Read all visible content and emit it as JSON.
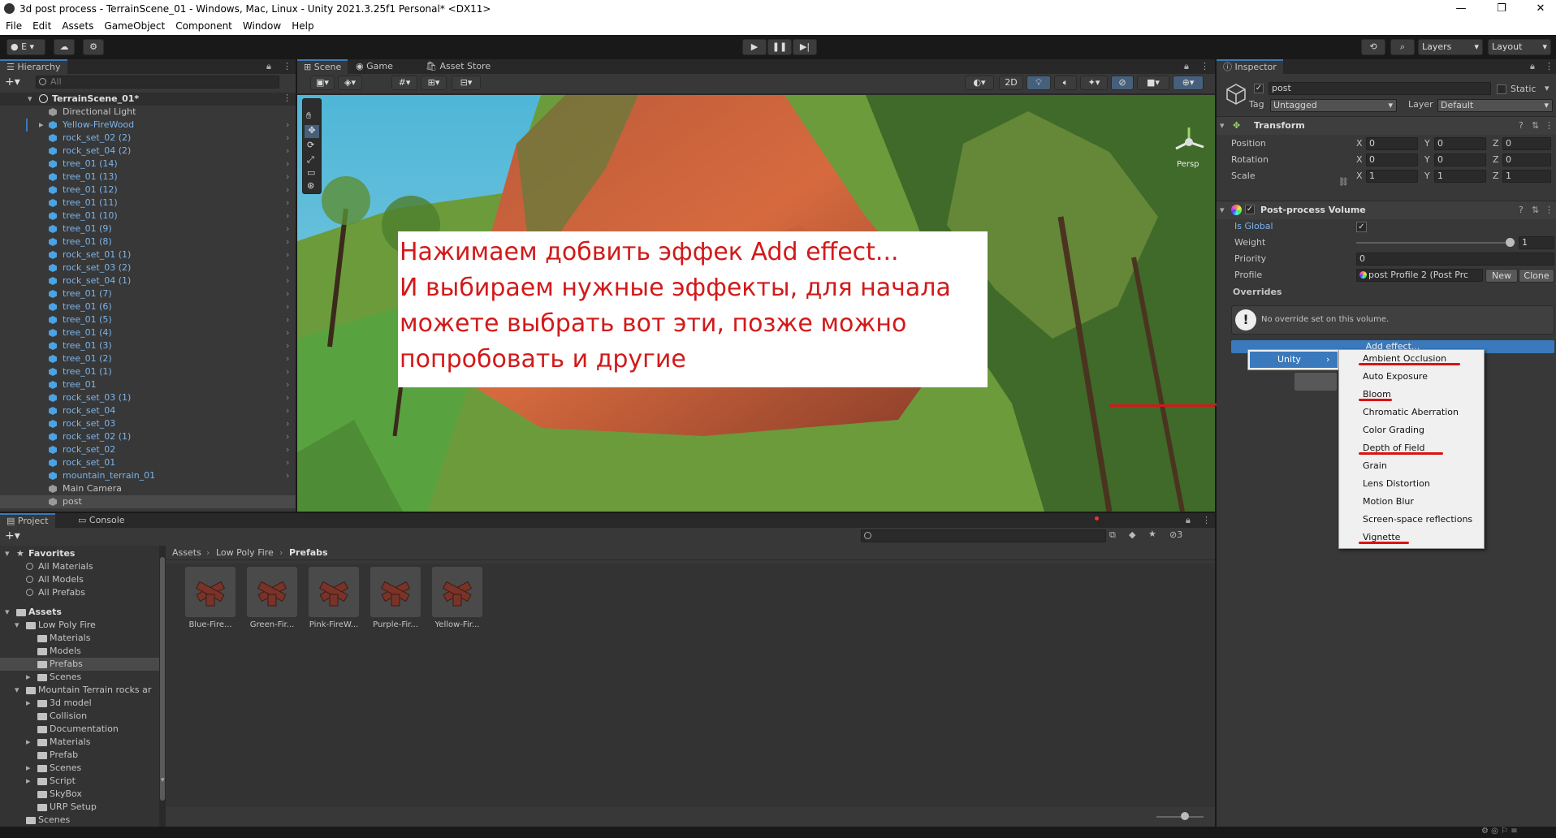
{
  "window": {
    "title": "3d post process - TerrainScene_01 - Windows, Mac, Linux - Unity 2021.3.25f1 Personal* <DX11>",
    "minimize": "—",
    "maximize": "❐",
    "close": "✕"
  },
  "menu": [
    "File",
    "Edit",
    "Assets",
    "GameObject",
    "Component",
    "Window",
    "Help"
  ],
  "toolbar": {
    "account": "E",
    "layers": "Layers",
    "layout": "Layout"
  },
  "hierarchy": {
    "tab": "Hierarchy",
    "search_placeholder": "All",
    "scene": "TerrainScene_01*",
    "items": [
      {
        "label": "Directional Light",
        "blue": false,
        "arrow": false,
        "chev": false
      },
      {
        "label": "Yellow-FireWood",
        "blue": true,
        "arrow": true,
        "chev": true
      },
      {
        "label": "rock_set_02 (2)",
        "blue": true,
        "arrow": false,
        "chev": true
      },
      {
        "label": "rock_set_04 (2)",
        "blue": true,
        "arrow": false,
        "chev": true
      },
      {
        "label": "tree_01 (14)",
        "blue": true,
        "arrow": false,
        "chev": true
      },
      {
        "label": "tree_01 (13)",
        "blue": true,
        "arrow": false,
        "chev": true
      },
      {
        "label": "tree_01 (12)",
        "blue": true,
        "arrow": false,
        "chev": true
      },
      {
        "label": "tree_01 (11)",
        "blue": true,
        "arrow": false,
        "chev": true
      },
      {
        "label": "tree_01 (10)",
        "blue": true,
        "arrow": false,
        "chev": true
      },
      {
        "label": "tree_01 (9)",
        "blue": true,
        "arrow": false,
        "chev": true
      },
      {
        "label": "tree_01 (8)",
        "blue": true,
        "arrow": false,
        "chev": true
      },
      {
        "label": "rock_set_01 (1)",
        "blue": true,
        "arrow": false,
        "chev": true
      },
      {
        "label": "rock_set_03 (2)",
        "blue": true,
        "arrow": false,
        "chev": true
      },
      {
        "label": "rock_set_04 (1)",
        "blue": true,
        "arrow": false,
        "chev": true
      },
      {
        "label": "tree_01 (7)",
        "blue": true,
        "arrow": false,
        "chev": true
      },
      {
        "label": "tree_01 (6)",
        "blue": true,
        "arrow": false,
        "chev": true
      },
      {
        "label": "tree_01 (5)",
        "blue": true,
        "arrow": false,
        "chev": true
      },
      {
        "label": "tree_01 (4)",
        "blue": true,
        "arrow": false,
        "chev": true
      },
      {
        "label": "tree_01 (3)",
        "blue": true,
        "arrow": false,
        "chev": true
      },
      {
        "label": "tree_01 (2)",
        "blue": true,
        "arrow": false,
        "chev": true
      },
      {
        "label": "tree_01 (1)",
        "blue": true,
        "arrow": false,
        "chev": true
      },
      {
        "label": "tree_01",
        "blue": true,
        "arrow": false,
        "chev": true
      },
      {
        "label": "rock_set_03 (1)",
        "blue": true,
        "arrow": false,
        "chev": true
      },
      {
        "label": "rock_set_04",
        "blue": true,
        "arrow": false,
        "chev": true
      },
      {
        "label": "rock_set_03",
        "blue": true,
        "arrow": false,
        "chev": true
      },
      {
        "label": "rock_set_02 (1)",
        "blue": true,
        "arrow": false,
        "chev": true
      },
      {
        "label": "rock_set_02",
        "blue": true,
        "arrow": false,
        "chev": true
      },
      {
        "label": "rock_set_01",
        "blue": true,
        "arrow": false,
        "chev": true
      },
      {
        "label": "mountain_terrain_01",
        "blue": true,
        "arrow": false,
        "chev": true
      },
      {
        "label": "Main Camera",
        "blue": false,
        "arrow": false,
        "chev": false
      },
      {
        "label": "post",
        "blue": false,
        "arrow": false,
        "chev": false
      }
    ]
  },
  "scene": {
    "tabs": [
      "Scene",
      "Game",
      "Asset Store"
    ],
    "mode_2d": "2D",
    "persp": "Persp",
    "annotation": [
      "Нажимаем добвить эффек Add effect...",
      "И выбираем нужные эффекты, для начала",
      "можете выбрать вот эти, позже можно",
      "попробовать и другие"
    ]
  },
  "inspector": {
    "tab": "Inspector",
    "object_name": "post",
    "static": "Static",
    "tag_label": "Tag",
    "tag": "Untagged",
    "layer_label": "Layer",
    "layer": "Default",
    "transform": {
      "title": "Transform",
      "rows": [
        {
          "label": "Position",
          "x": "0",
          "y": "0",
          "z": "0"
        },
        {
          "label": "Rotation",
          "x": "0",
          "y": "0",
          "z": "0"
        },
        {
          "label": "Scale",
          "x": "1",
          "y": "1",
          "z": "1"
        }
      ]
    },
    "axis": {
      "x": "X",
      "y": "Y",
      "z": "Z"
    },
    "ppv": {
      "title": "Post-process Volume",
      "is_global": "Is Global",
      "weight": "Weight",
      "weight_value": "1",
      "weight_fraction": 1.0,
      "priority": "Priority",
      "priority_value": "0",
      "profile": "Profile",
      "profile_value": "post Profile 2 (Post Prc",
      "new": "New",
      "clone": "Clone",
      "overrides": "Overrides",
      "no_override": "No override set on this volume.",
      "add_effect": "Add effect..."
    }
  },
  "context_menu": {
    "parent": "Unity",
    "items": [
      "Ambient Occlusion",
      "Auto Exposure",
      "Bloom",
      "Chromatic Aberration",
      "Color Grading",
      "Depth of Field",
      "Grain",
      "Lens Distortion",
      "Motion Blur",
      "Screen-space reflections",
      "Vignette"
    ],
    "underlined": [
      "Ambient Occlusion",
      "Bloom",
      "Depth of Field",
      "Vignette"
    ]
  },
  "project": {
    "tabs": [
      "Project",
      "Console"
    ],
    "breadcrumb": [
      "Assets",
      "Low Poly Fire",
      "Prefabs"
    ],
    "hidden_count": "3",
    "favorites_title": "Favorites",
    "favorites": [
      "All Materials",
      "All Models",
      "All Prefabs"
    ],
    "assets_title": "Assets",
    "tree": [
      {
        "label": "Low Poly Fire",
        "level": 1,
        "open": true,
        "sel": false
      },
      {
        "label": "Materials",
        "level": 2,
        "open": false,
        "sel": false
      },
      {
        "label": "Models",
        "level": 2,
        "open": false,
        "sel": false
      },
      {
        "label": "Prefabs",
        "level": 2,
        "open": false,
        "sel": true
      },
      {
        "label": "Scenes",
        "level": 2,
        "open": false,
        "sel": false,
        "arrow": true
      },
      {
        "label": "Mountain Terrain rocks ar",
        "level": 1,
        "open": true,
        "sel": false
      },
      {
        "label": "3d model",
        "level": 2,
        "open": false,
        "sel": false,
        "arrow": true
      },
      {
        "label": "Collision",
        "level": 2,
        "open": false,
        "sel": false
      },
      {
        "label": "Documentation",
        "level": 2,
        "open": false,
        "sel": false
      },
      {
        "label": "Materials",
        "level": 2,
        "open": false,
        "sel": false,
        "arrow": true
      },
      {
        "label": "Prefab",
        "level": 2,
        "open": false,
        "sel": false
      },
      {
        "label": "Scenes",
        "level": 2,
        "open": false,
        "sel": false,
        "arrow": true
      },
      {
        "label": "Script",
        "level": 2,
        "open": false,
        "sel": false,
        "arrow": true
      },
      {
        "label": "SkyBox",
        "level": 2,
        "open": false,
        "sel": false
      },
      {
        "label": "URP Setup",
        "level": 2,
        "open": false,
        "sel": false
      },
      {
        "label": "Scenes",
        "level": 1,
        "open": false,
        "sel": false
      }
    ],
    "prefabs": [
      "Blue-Fire...",
      "Green-Fir...",
      "Pink-FireW...",
      "Purple-Fir...",
      "Yellow-Fir..."
    ]
  },
  "colors": {
    "accent": "#3a79bb",
    "annotation": "#d11a1a",
    "selected": "#2c5d87"
  }
}
